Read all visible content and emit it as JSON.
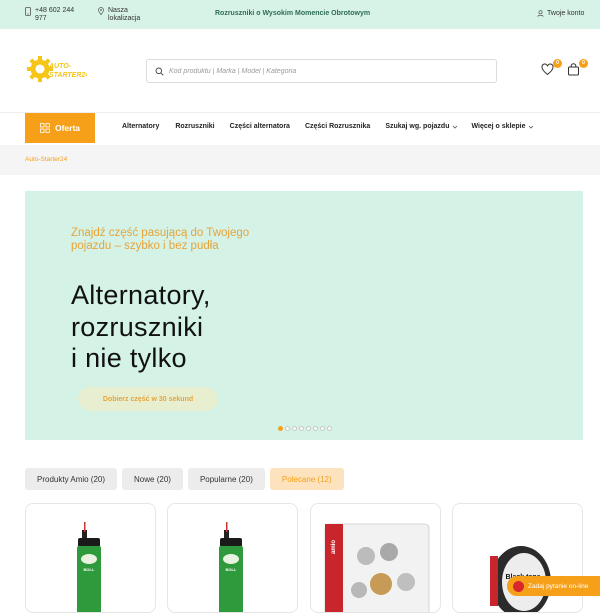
{
  "topbar": {
    "phone": "+48 602 244 977",
    "location": "Nasza lokalizacja",
    "promo": "Rozruszniki o Wysokim Momencie Obrotowym",
    "account": "Twoje konto"
  },
  "header": {
    "logo_text": "AUTO-STARTER24",
    "search_placeholder": "Kod produktu | Marka | Model | Kategoria",
    "wishlist_count": "0",
    "cart_count": "0"
  },
  "nav": {
    "offer_label": "Oferta",
    "items": [
      {
        "label": "Alternatory"
      },
      {
        "label": "Rozruszniki"
      },
      {
        "label": "Części alternatora"
      },
      {
        "label": "Części Rozrusznika"
      },
      {
        "label": "Szukaj wg. pojazdu"
      },
      {
        "label": "Więcej o sklepie"
      }
    ]
  },
  "breadcrumb": "Auto-Starter24",
  "hero": {
    "subtitle": "Znajdź część pasującą do Twojego pojazdu – szybko i bez pudła",
    "title_line1": "Alternatory,",
    "title_line2": "rozruszniki",
    "title_line3": "i nie tylko",
    "cta": "Dobierz część w 30 sekund",
    "slides": 8,
    "active_slide": 1
  },
  "tabs": [
    {
      "label": "Produkty Amio (20)"
    },
    {
      "label": "Nowe (20)"
    },
    {
      "label": "Popularne (20)"
    },
    {
      "label": "Polecane (12)"
    }
  ],
  "products": {
    "spray1_brand": "BOLL",
    "spray2_brand": "BOLL",
    "box_brand": "amio",
    "tape_text": "Black tape"
  },
  "chat": "Zadaj pytanie on-line",
  "colors": {
    "accent": "#f6a01a",
    "topbar_bg": "#d7f3e7",
    "hero_bg": "#d4f2e6"
  }
}
